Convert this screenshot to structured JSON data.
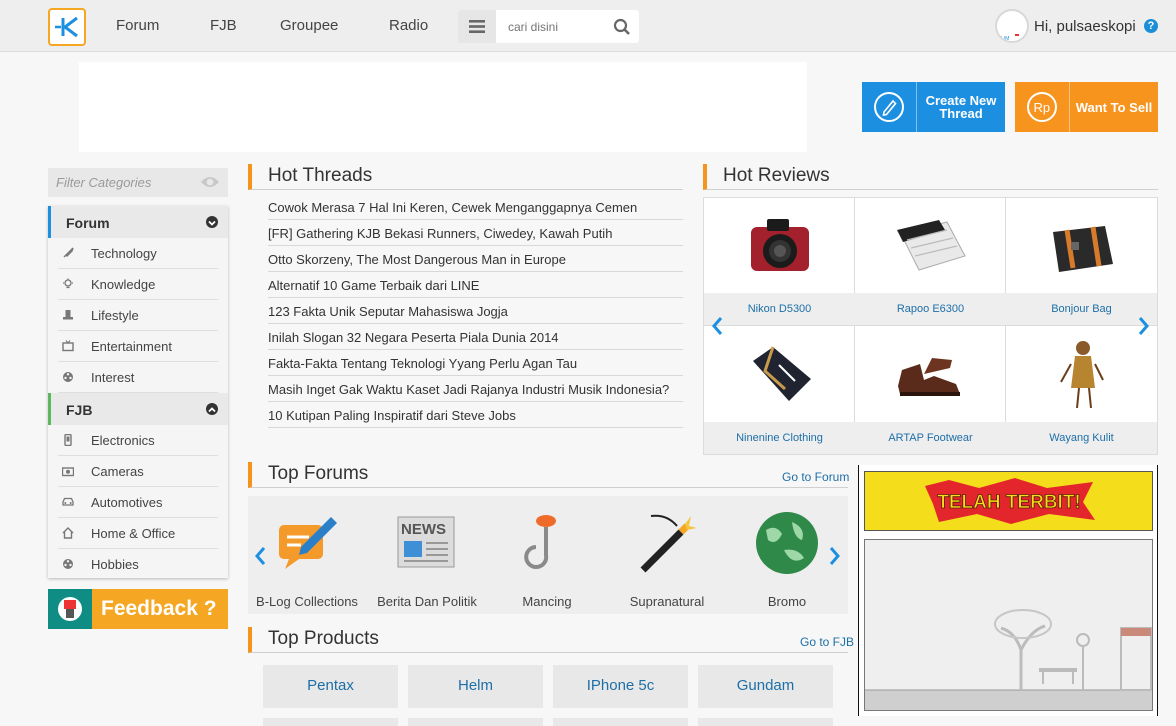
{
  "header": {
    "nav": [
      "Forum",
      "FJB",
      "Groupee",
      "Radio"
    ],
    "search_placeholder": "cari disini",
    "greeting": "Hi, pulsaeskopi",
    "help_glyph": "?"
  },
  "actions": {
    "create_thread": "Create New Thread",
    "want_to_sell": "Want To Sell"
  },
  "sidebar": {
    "filter_placeholder": "Filter Categories",
    "forum_heading": "Forum",
    "forum_items": [
      {
        "label": "Technology",
        "icon": "rocket-icon"
      },
      {
        "label": "Knowledge",
        "icon": "lightbulb-icon"
      },
      {
        "label": "Lifestyle",
        "icon": "hat-icon"
      },
      {
        "label": "Entertainment",
        "icon": "tv-icon"
      },
      {
        "label": "Interest",
        "icon": "film-reel-icon"
      }
    ],
    "fjb_heading": "FJB",
    "fjb_items": [
      {
        "label": "Electronics",
        "icon": "phone-icon"
      },
      {
        "label": "Cameras",
        "icon": "camera-icon"
      },
      {
        "label": "Automotives",
        "icon": "car-icon"
      },
      {
        "label": "Home & Office",
        "icon": "home-icon"
      },
      {
        "label": "Hobbies",
        "icon": "film-reel-icon"
      }
    ],
    "feedback": "Feedback ?"
  },
  "hot_threads": {
    "title": "Hot Threads",
    "items": [
      "Cowok Merasa 7 Hal Ini Keren, Cewek Menganggapnya Cemen",
      "[FR] Gathering KJB Bekasi Runners, Ciwedey, Kawah Putih",
      "Otto Skorzeny, The Most Dangerous Man in Europe",
      "Alternatif 10 Game Terbaik dari LINE",
      "123 Fakta Unik Seputar Mahasiswa Jogja",
      "Inilah Slogan 32 Negara Peserta Piala Dunia 2014",
      "Fakta-Fakta Tentang Teknologi Yyang Perlu Agan Tau",
      "Masih Inget Gak Waktu Kaset Jadi Rajanya Industri Musik Indonesia?",
      "10 Kutipan Paling Inspiratif dari Steve Jobs"
    ]
  },
  "hot_reviews": {
    "title": "Hot Reviews",
    "items": [
      "Nikon D5300",
      "Rapoo E6300",
      "Bonjour Bag",
      "Ninenine Clothing",
      "ARTAP Footwear",
      "Wayang Kulit"
    ]
  },
  "top_forums": {
    "title": "Top Forums",
    "link": "Go to Forum",
    "items": [
      "B-Log Collections",
      "Berita Dan Politik",
      "Mancing",
      "Supranatural",
      "Bromo"
    ],
    "news_badge": "NEWS"
  },
  "top_products": {
    "title": "Top Products",
    "link": "Go to FJB",
    "items": [
      "Pentax",
      "Helm",
      "IPhone 5c",
      "Gundam"
    ]
  },
  "ads": {
    "terbit_text": "TELAH TERBIT!"
  },
  "colors": {
    "accent_orange": "#f5941d",
    "accent_blue": "#1d8fe1",
    "link_blue": "#1d6fa8",
    "fjb_green": "#5cb85c"
  }
}
